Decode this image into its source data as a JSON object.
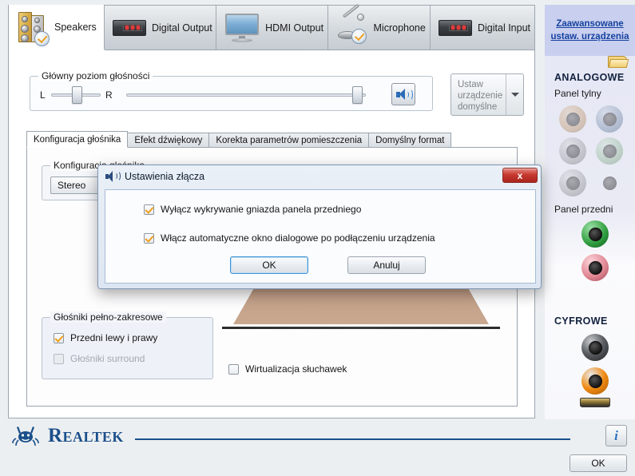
{
  "window": {
    "advanced_link": "Zaawansowane ustaw. urządzenia"
  },
  "device_tabs": [
    {
      "label": "Speakers",
      "icon": "speakers-icon",
      "active": true
    },
    {
      "label": "Digital Output",
      "icon": "digital-device-icon",
      "active": false
    },
    {
      "label": "HDMI Output",
      "icon": "monitor-icon",
      "active": false
    },
    {
      "label": "Microphone",
      "icon": "microphone-icon",
      "active": false
    },
    {
      "label": "Digital Input",
      "icon": "digital-device-icon",
      "active": false
    }
  ],
  "volume": {
    "legend": "Główny poziom głośności",
    "left_label": "L",
    "right_label": "R",
    "balance_value": 50,
    "master_value": 92,
    "mute_button_icon": "speaker-volume-icon"
  },
  "default_device": {
    "label": "Ustaw urządzenie domyślne",
    "enabled": false,
    "dropdown_icon": "chevron-down-icon"
  },
  "inner_tabs": [
    {
      "label": "Konfiguracja głośnika",
      "active": true
    },
    {
      "label": "Efekt dźwiękowy",
      "active": false
    },
    {
      "label": "Korekta parametrów pomieszczenia",
      "active": false
    },
    {
      "label": "Domyślny format",
      "active": false
    }
  ],
  "speaker_config": {
    "legend": "Konfiguracja głośnika",
    "selected": "Stereo",
    "dropdown_icon": "chevron-down-icon"
  },
  "full_range": {
    "legend": "Głośniki pełno-zakresowe",
    "items": [
      {
        "label": "Przedni lewy i prawy",
        "checked": true,
        "disabled": false
      },
      {
        "label": "Głośniki surround",
        "checked": false,
        "disabled": true
      }
    ]
  },
  "headphone_virtualization": {
    "label": "Wirtualizacja słuchawek",
    "checked": false
  },
  "sidebar": {
    "folder_icon": "folder-icon",
    "analog": {
      "title": "ANALOGOWE",
      "rear_label": "Panel tylny",
      "rear_jacks": [
        {
          "name": "jack-orange",
          "color": "#d98a3c",
          "active": false
        },
        {
          "name": "jack-blue",
          "color": "#5c86c4",
          "active": false
        },
        {
          "name": "jack-gray",
          "color": "#8d9196",
          "active": false
        },
        {
          "name": "jack-green",
          "color": "#6fb77a",
          "active": false
        },
        {
          "name": "jack-gray",
          "color": "#8d9196",
          "active": false
        },
        {
          "name": "jack-pink",
          "color": "#e09aa6",
          "active": false
        }
      ],
      "front_label": "Panel przedni",
      "front_jacks": [
        {
          "name": "jack-green",
          "color": "#2f9e3f",
          "active": true
        },
        {
          "name": "jack-pink",
          "color": "#e08592",
          "active": true
        }
      ]
    },
    "digital": {
      "title": "CYFROWE",
      "jacks": [
        {
          "name": "jack-black-spdif",
          "color": "#3a3a3a",
          "active": true
        },
        {
          "name": "jack-orange-coax",
          "color": "#f08a10",
          "active": true
        }
      ],
      "hdmi_label": "hdmi-connector-icon"
    }
  },
  "dialog": {
    "title": "Ustawienia złącza",
    "title_icon": "speaker-icon",
    "close_label": "x",
    "options": [
      {
        "label": "Wyłącz wykrywanie gniazda panela przedniego",
        "checked": true
      },
      {
        "label": "Włącz automatyczne okno dialogowe po podłączeniu urządzenia",
        "checked": true
      }
    ],
    "ok_label": "OK",
    "cancel_label": "Anuluj"
  },
  "footer": {
    "brand": "Realtek",
    "info_label": "i",
    "ok_label": "OK"
  }
}
